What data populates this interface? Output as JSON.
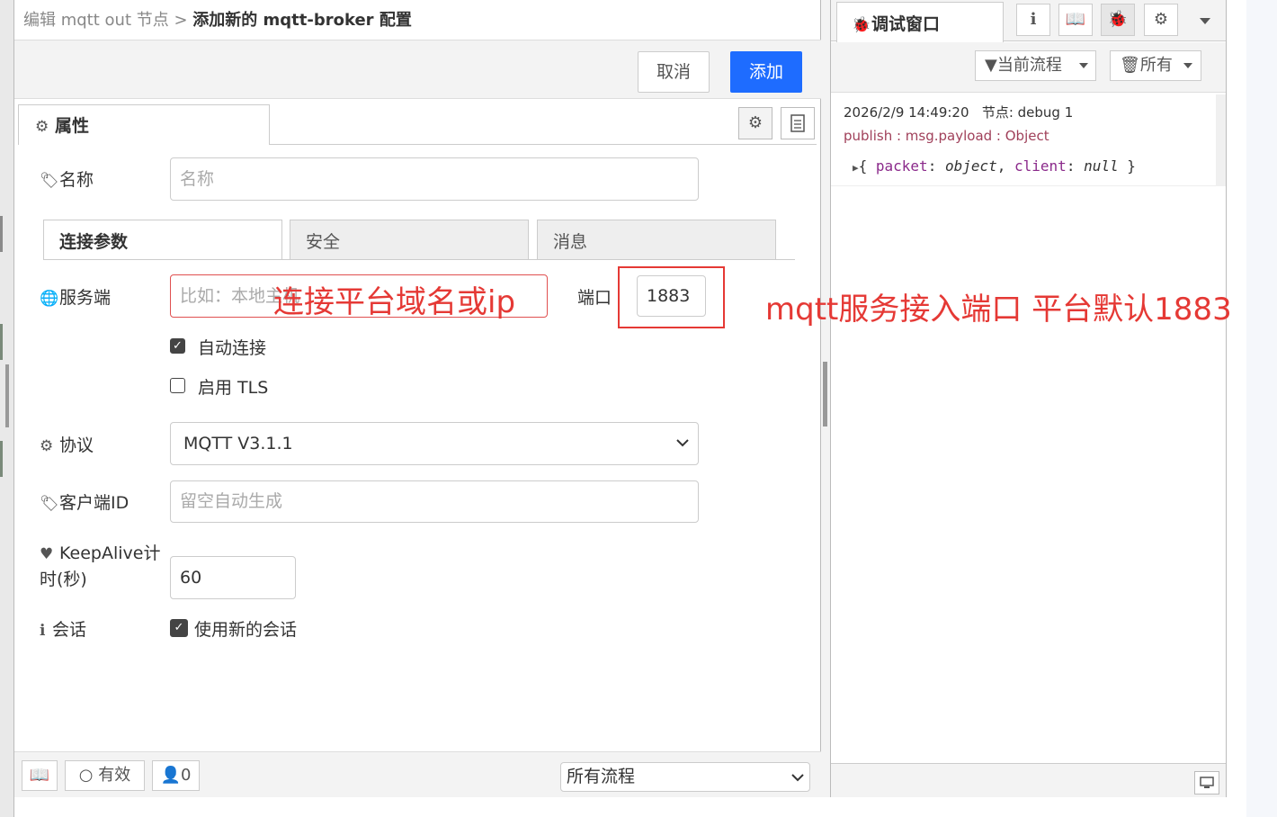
{
  "editor": {
    "breadcrumb_prefix": "编辑 mqtt out 节点 >",
    "breadcrumb_current": "添加新的 mqtt-broker 配置",
    "cancel_label": "取消",
    "add_label": "添加",
    "props_tab_label": "属性"
  },
  "form": {
    "name_label": "名称",
    "name_placeholder": "名称",
    "subtabs": [
      "连接参数",
      "安全",
      "消息"
    ],
    "server_label": "服务端",
    "server_placeholder": "比如：本地主机",
    "port_label": "端口",
    "port_value": "1883",
    "auto_connect_label": "自动连接",
    "auto_connect_checked": true,
    "tls_label": "启用 TLS",
    "tls_checked": false,
    "protocol_label": "协议",
    "protocol_value": "MQTT V3.1.1",
    "client_id_label": "客户端ID",
    "client_id_placeholder": "留空自动生成",
    "keepalive_label_line1": "KeepAlive计",
    "keepalive_label_line2": "时(秒)",
    "keepalive_value": "60",
    "session_label": "会话",
    "session_checkbox_label": "使用新的会话",
    "session_checked": true
  },
  "annotations": {
    "server_note": "连接平台域名或ip",
    "port_note": "mqtt服务接入端口 平台默认1883"
  },
  "bottom_bar": {
    "status_label": "有效",
    "users_count": "0",
    "scope_value": "所有流程"
  },
  "debug": {
    "tab_label": "调试窗口",
    "filter_label": "当前流程",
    "clear_label": "所有",
    "msg_timestamp": "2026/2/9 14:49:20",
    "msg_node": "节点: debug 1",
    "msg_topic": "publish : msg.payload : Object",
    "msg_body_key1": "packet",
    "msg_body_val1": "object",
    "msg_body_key2": "client",
    "msg_body_val2": "null"
  },
  "colors": {
    "accent": "#1e6cff",
    "annotation": "#e53935",
    "debug_topic": "#a0405a"
  }
}
